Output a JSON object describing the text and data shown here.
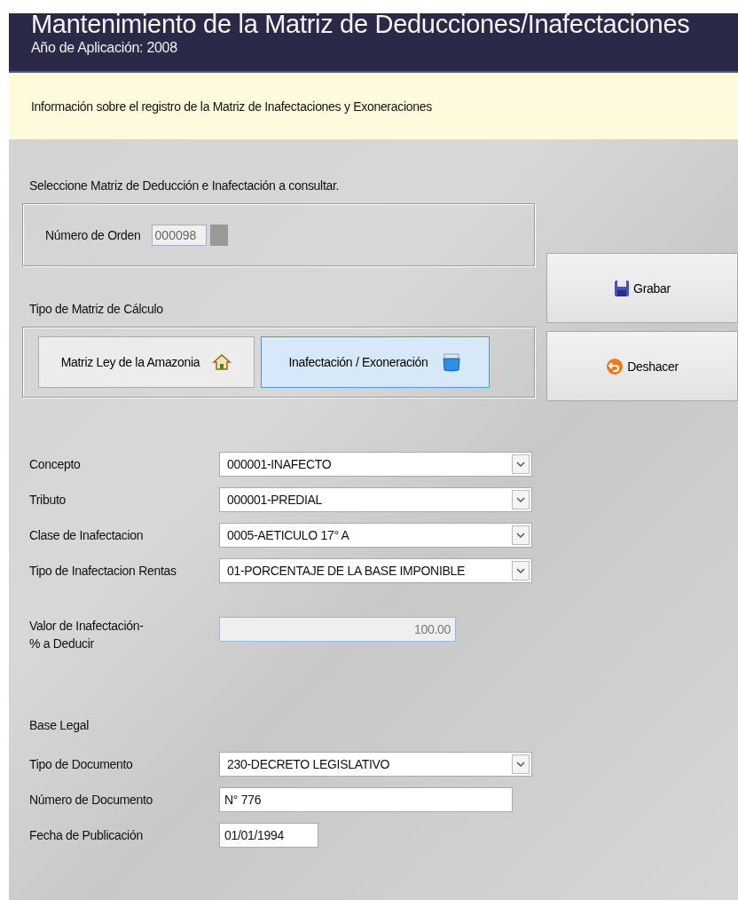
{
  "header": {
    "title": "Mantenimiento de la Matriz de Deducciones/Inafectaciones",
    "subtitle": "Año de Aplicación: 2008"
  },
  "info": "Información sobre el registro de la Matriz de Inafectaciones y Exoneraciones",
  "select_label": "Seleccione Matriz de Deducción e Inafectación a consultar.",
  "order": {
    "label": "Número de Orden",
    "value": "000098"
  },
  "matrix_type": {
    "label": "Tipo de Matriz de Cálculo",
    "options": [
      {
        "label": "Matriz Ley de la Amazonia",
        "kind": "house",
        "selected": false
      },
      {
        "label": "Inafectación / Exoneración",
        "kind": "bin",
        "selected": true
      }
    ]
  },
  "actions": [
    {
      "label": "Grabar",
      "kind": "save"
    },
    {
      "label": "Deshacer",
      "kind": "undo"
    }
  ],
  "fields": [
    {
      "label": "Concepto",
      "kind": "combo",
      "value": "000001-INAFECTO"
    },
    {
      "label": "Tributo",
      "kind": "combo",
      "value": "000001-PREDIAL"
    },
    {
      "label": "Clase de Inafectacion",
      "kind": "combo",
      "value": "0005-AETICULO 17° A"
    },
    {
      "label": "Tipo de Inafectacion Rentas",
      "kind": "combo",
      "value": "01-PORCENTAJE DE LA BASE IMPONIBLE"
    },
    {
      "label": "Valor de Inafectación-\n% a Deducir",
      "kind": "number",
      "value": "100.00"
    }
  ],
  "legal": {
    "label": "Base Legal",
    "fields": [
      {
        "label": "Tipo de Documento",
        "kind": "combo",
        "value": "230-DECRETO LEGISLATIVO"
      },
      {
        "label": "Número de Documento",
        "kind": "text",
        "value": "N° 776"
      },
      {
        "label": "Fecha de Publicación",
        "kind": "date",
        "value": "01/01/1994"
      }
    ]
  }
}
